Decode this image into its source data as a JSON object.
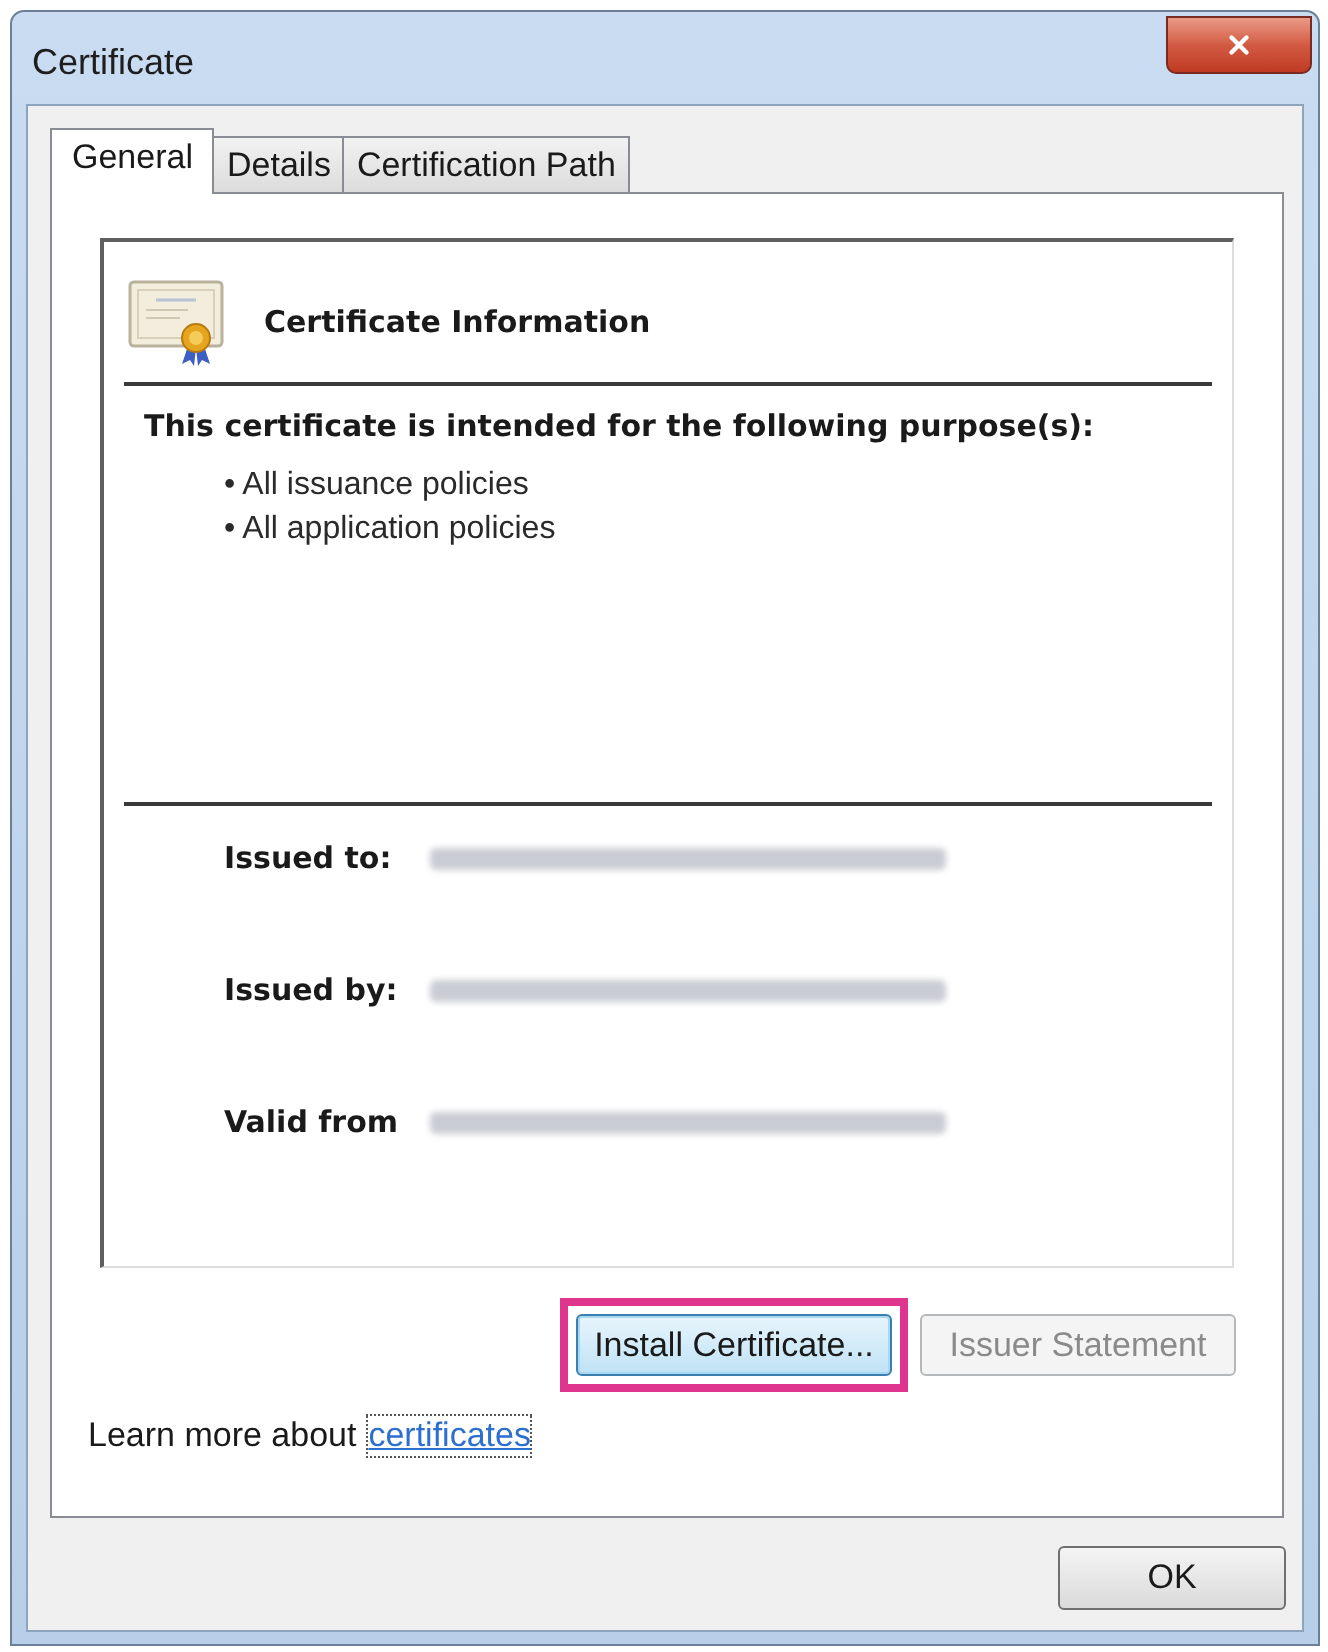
{
  "window": {
    "title": "Certificate"
  },
  "tabs": [
    {
      "label": "General",
      "selected": true
    },
    {
      "label": "Details",
      "selected": false
    },
    {
      "label": "Certification Path",
      "selected": false
    }
  ],
  "info": {
    "heading": "Certificate Information",
    "purpose_title": "This certificate is intended for the following purpose(s):",
    "purposes": [
      "• All issuance policies",
      "• All application policies"
    ],
    "fields": [
      {
        "label": "Issued to:",
        "redacted": true
      },
      {
        "label": "Issued by:",
        "redacted": true
      },
      {
        "label": "Valid from",
        "redacted": true
      }
    ]
  },
  "buttons": [
    {
      "label": "Install Certificate...",
      "disabled": false,
      "focused": true,
      "highlighted": true
    },
    {
      "label": "Issuer Statement",
      "disabled": true,
      "focused": false,
      "highlighted": false
    }
  ],
  "learn_more": {
    "text": "Learn more about",
    "link": "certificates"
  },
  "footer_buttons": [
    "OK"
  ]
}
